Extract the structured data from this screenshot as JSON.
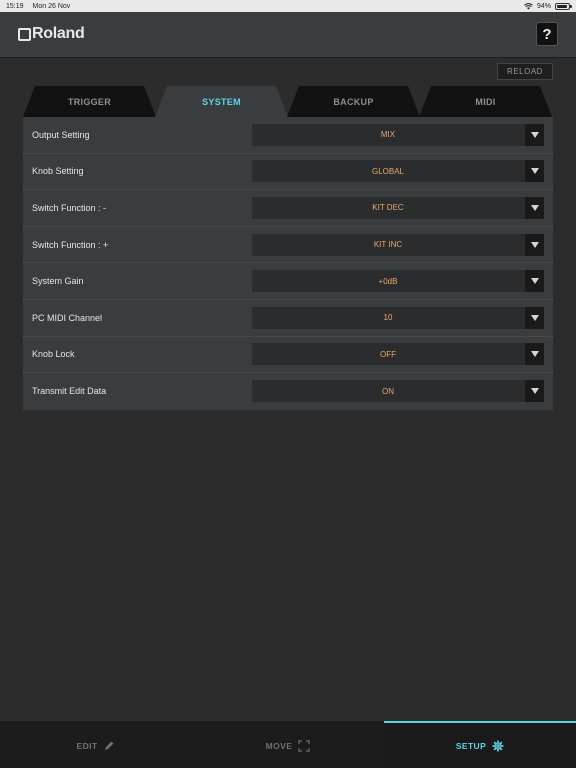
{
  "status": {
    "time": "15:19",
    "date": "Mon 26 Nov",
    "battery": "94%",
    "battery_level": 0.94
  },
  "header": {
    "logo_text": "Roland",
    "help_label": "?"
  },
  "toolbar": {
    "reload_label": "RELOAD"
  },
  "tabs": [
    {
      "label": "TRIGGER",
      "active": false
    },
    {
      "label": "SYSTEM",
      "active": true
    },
    {
      "label": "BACKUP",
      "active": false
    },
    {
      "label": "MIDI",
      "active": false
    }
  ],
  "settings": [
    {
      "label": "Output Setting",
      "value": "MIX"
    },
    {
      "label": "Knob Setting",
      "value": "GLOBAL"
    },
    {
      "label": "Switch Function : -",
      "value": "KIT DEC"
    },
    {
      "label": "Switch Function : +",
      "value": "KIT INC"
    },
    {
      "label": "System Gain",
      "value": "+0dB"
    },
    {
      "label": "PC MIDI Channel",
      "value": "10"
    },
    {
      "label": "Knob Lock",
      "value": "OFF"
    },
    {
      "label": "Transmit Edit Data",
      "value": "ON"
    }
  ],
  "nav": [
    {
      "label": "EDIT",
      "icon": "pencil-icon",
      "active": false
    },
    {
      "label": "MOVE",
      "icon": "expand-icon",
      "active": false
    },
    {
      "label": "SETUP",
      "icon": "gear-icon",
      "active": true
    }
  ],
  "colors": {
    "accent": "#5fd3e6",
    "value": "#e8a96a",
    "panel": "#3a3d3f",
    "background": "#2c2c2c"
  }
}
